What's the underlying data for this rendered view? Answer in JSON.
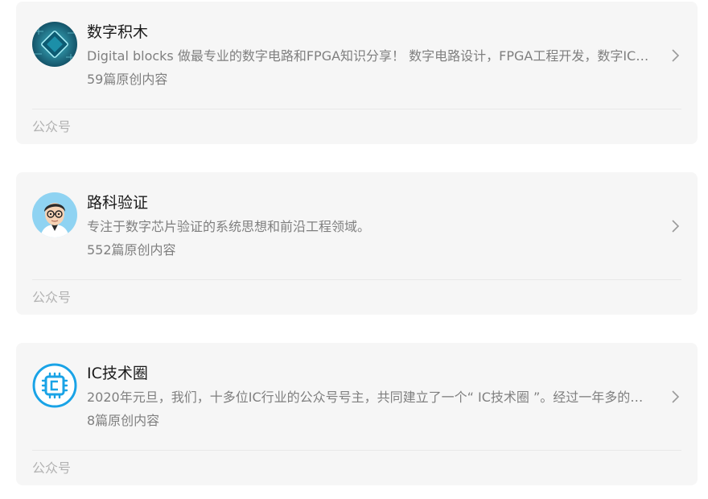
{
  "accounts": [
    {
      "name": "数字积木",
      "description": "Digital blocks 做最专业的数字电路和FPGA知识分享！ 数字电路设计，FPGA工程开发，数字IC设计与验证",
      "article_count": "59篇原创内容",
      "type_label": "公众号",
      "avatar_icon": "chip-board-avatar-icon"
    },
    {
      "name": "路科验证",
      "description": "专注于数字芯片验证的系统思想和前沿工程领域。",
      "article_count": "552篇原创内容",
      "type_label": "公众号",
      "avatar_icon": "person-with-glasses-avatar-icon"
    },
    {
      "name": "IC技术圈",
      "description": "2020年元旦，我们，十多位IC行业的公众号号主，共同建立了一个“ IC技术圈 ”。经过一年多的运营",
      "article_count": "8篇原创内容",
      "type_label": "公众号",
      "avatar_icon": "chip-outline-avatar-icon"
    }
  ],
  "colors": {
    "card_background": "#f6f6f6",
    "title": "#1a1a1a",
    "secondary_text": "#7f7f7f",
    "type_label": "#b2b2b2",
    "accent_blue": "#1aa3e6"
  }
}
